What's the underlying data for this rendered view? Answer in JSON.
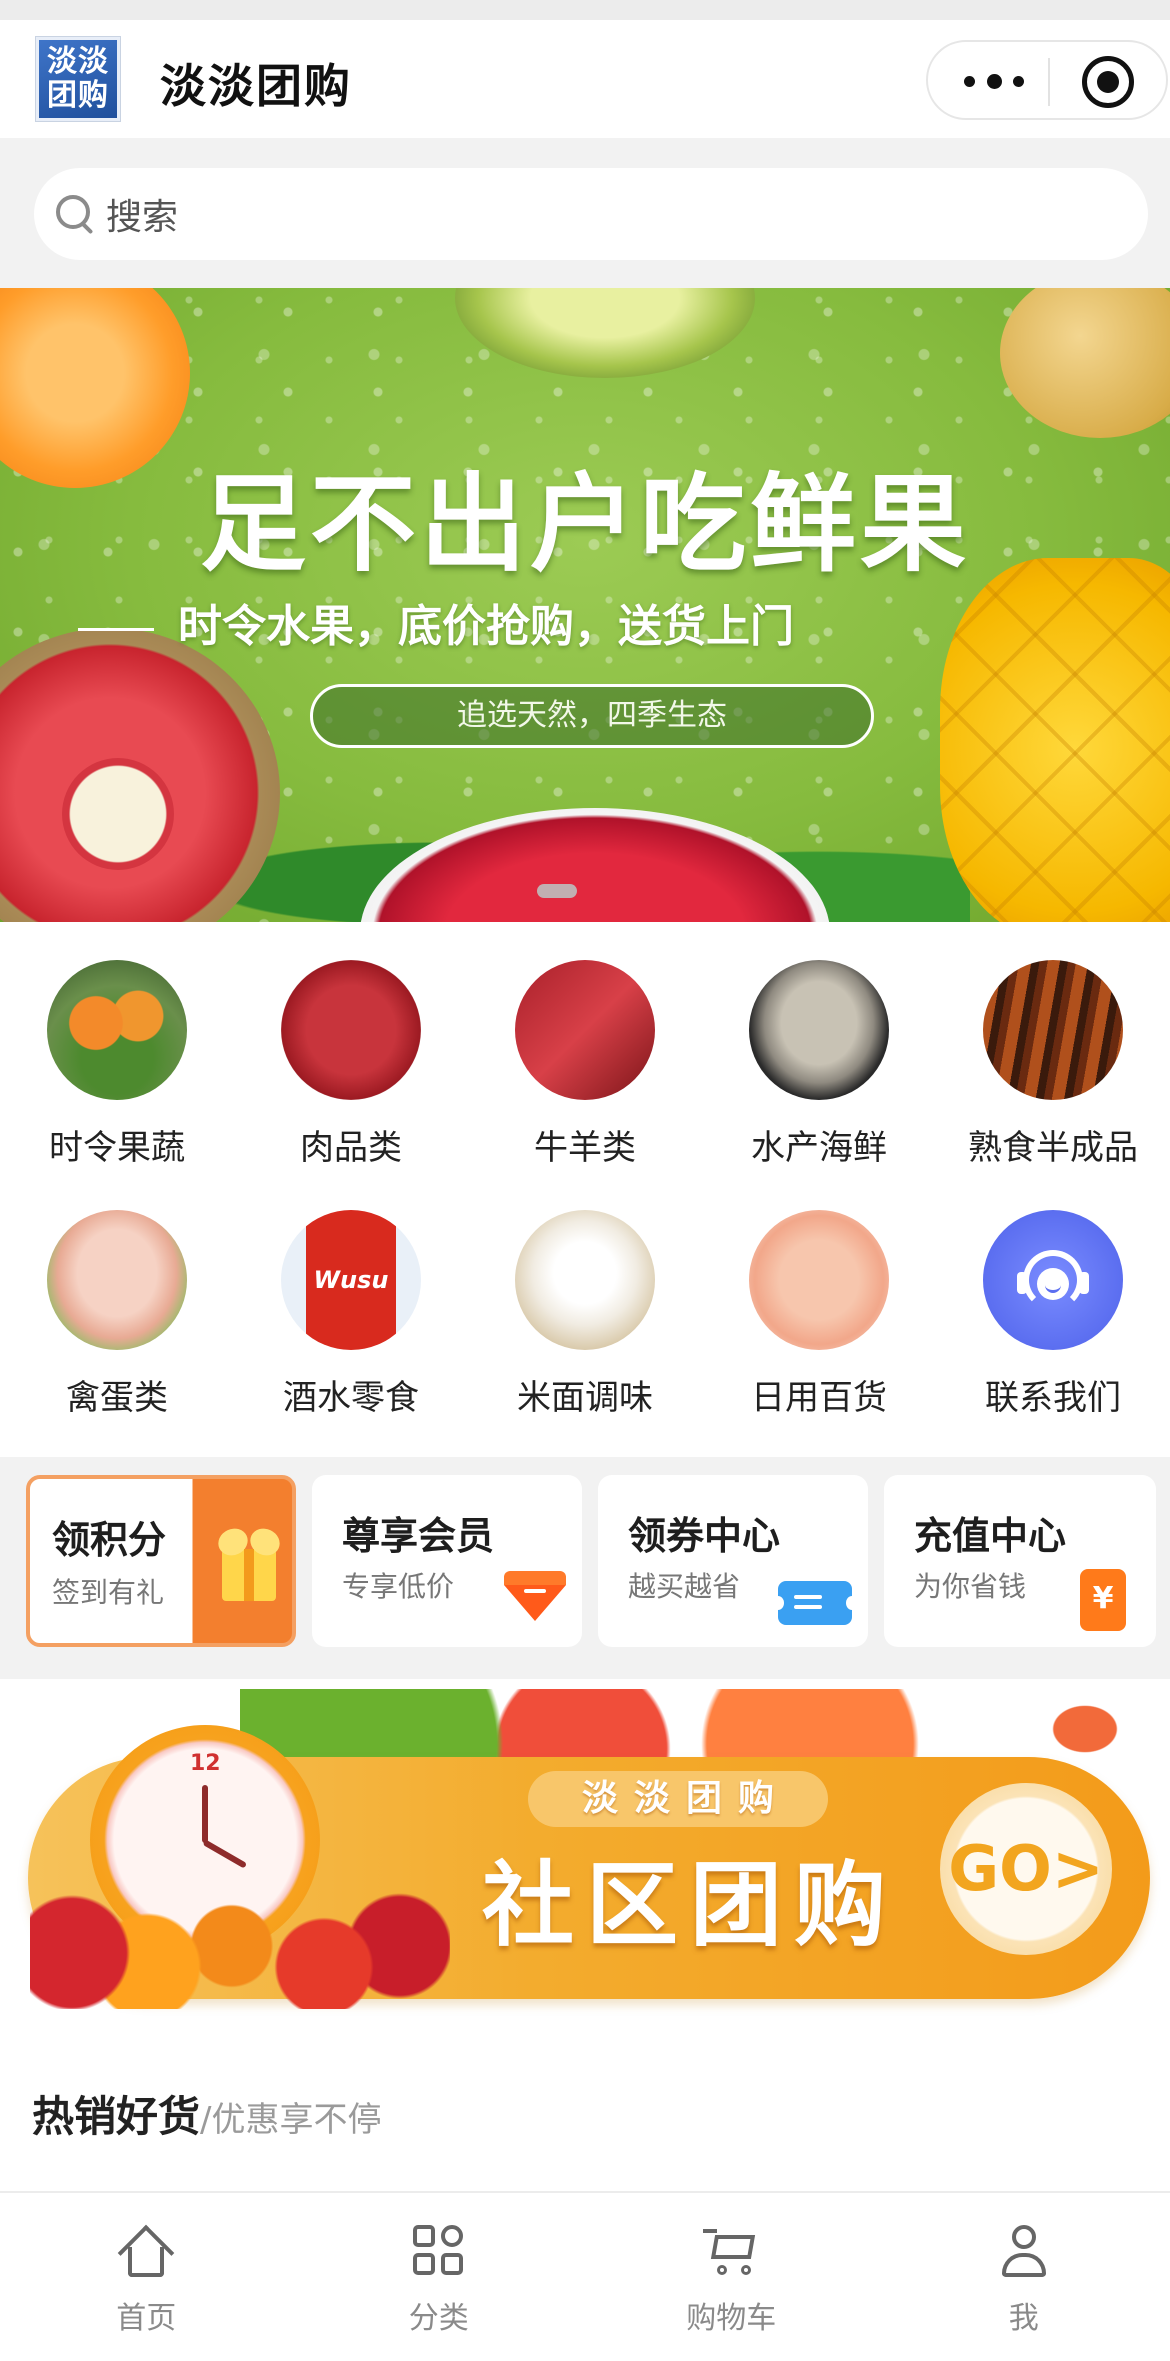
{
  "header": {
    "logo_line1": "淡淡",
    "logo_line2": "团购",
    "title": "淡淡团购"
  },
  "search": {
    "placeholder": "搜索"
  },
  "banner": {
    "title": "足不出户吃鲜果",
    "subtitle": "时令水果，底价抢购，送货上门",
    "pill": "追选天然，四季生态"
  },
  "categories": [
    {
      "label": "时令果蔬"
    },
    {
      "label": "肉品类"
    },
    {
      "label": "牛羊类"
    },
    {
      "label": "水产海鲜"
    },
    {
      "label": "熟食半成品"
    },
    {
      "label": "禽蛋类"
    },
    {
      "label": "酒水零食",
      "brand_text": "Wusu"
    },
    {
      "label": "米面调味"
    },
    {
      "label": "日用百货"
    },
    {
      "label": "联系我们"
    }
  ],
  "promos": [
    {
      "title": "领积分",
      "subtitle": "签到有礼"
    },
    {
      "title": "尊享会员",
      "subtitle": "专享低价"
    },
    {
      "title": "领券中心",
      "subtitle": "越买越省"
    },
    {
      "title": "充值中心",
      "subtitle": "为你省钱",
      "icon_text": "¥"
    }
  ],
  "community_banner": {
    "small_text": "淡淡团购",
    "big_text": "社区团购",
    "button": "GO>",
    "clock_number": "12"
  },
  "hot": {
    "title": "热销好货",
    "subtitle": "/优惠享不停"
  },
  "tabbar": [
    {
      "label": "首页",
      "icon": "home-icon"
    },
    {
      "label": "分类",
      "icon": "category-icon"
    },
    {
      "label": "购物车",
      "icon": "cart-icon"
    },
    {
      "label": "我",
      "icon": "user-icon"
    }
  ],
  "colors": {
    "accent_orange": "#f37f2e",
    "banner_green": "#86bb3e",
    "contact_blue": "#5b6ef0"
  }
}
